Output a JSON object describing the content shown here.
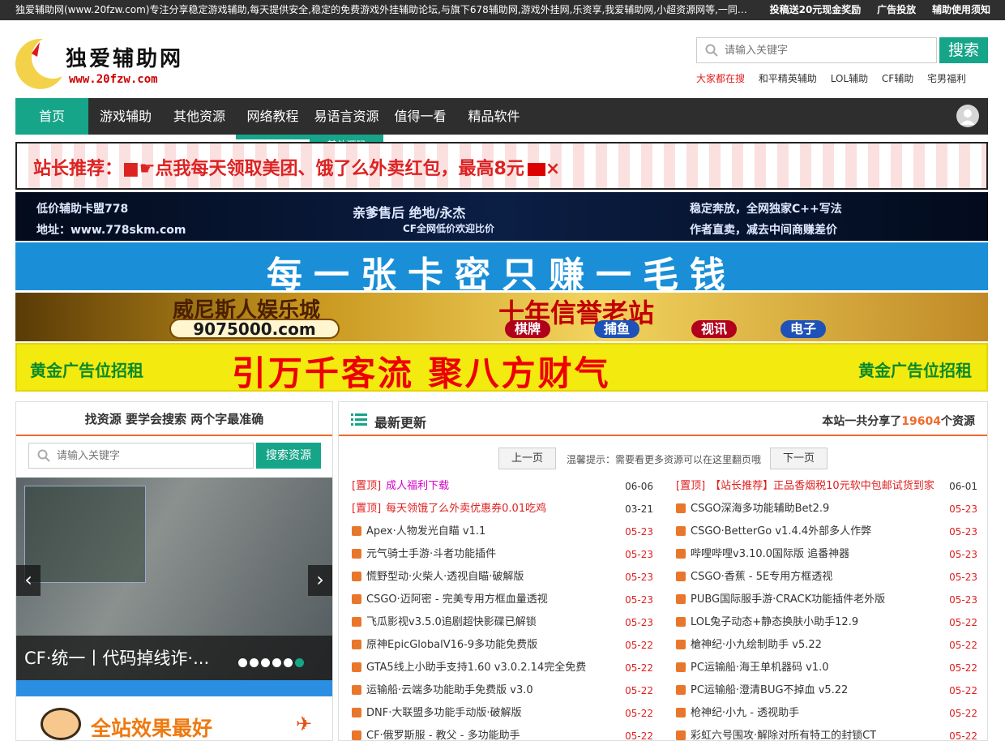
{
  "topbar": {
    "description": "独爱辅助网(www.20fzw.com)专注分享稳定游戏辅助,每天提供安全,稳定的免费游戏外挂辅助论坛,与旗下678辅助网,游戏外挂网,乐资享,我爱辅助网,小超资源网等,一同打造...",
    "links": [
      "投稿送20元现金奖励",
      "广告投放",
      "辅助使用须知"
    ]
  },
  "logo": {
    "name": "独爱辅助网",
    "url": "www.20fzw.com"
  },
  "search": {
    "placeholder": "请输入关键字",
    "button": "搜索"
  },
  "hot": {
    "label": "大家都在搜",
    "items": [
      "和平精英辅助",
      "LOL辅助",
      "CF辅助",
      "宅男福利"
    ]
  },
  "nav": {
    "items": [
      "首页",
      "游戏辅助",
      "其他资源",
      "网络教程",
      "易语言资源",
      "值得一看",
      "精品软件"
    ],
    "dropdown_item": "其他源码"
  },
  "banners": {
    "b1": "站长推荐：■☛点我每天领取美团、饿了么外卖红包，最高8元",
    "b1_close": "×",
    "b2_a": "低价辅助卡盟778",
    "b2_b": "地址：www.778skm.com",
    "b2_c": "亲爹售后  绝地/永杰",
    "b2_d": "CF全网低价欢迎比价",
    "b2_e": "稳定奔放，全网独家C++写法",
    "b2_f": "作者直卖，减去中间商赚差价",
    "b3": "每一张卡密只赚一毛钱",
    "b4_a": "威尼斯人娱乐城",
    "b4_b": "十年信誉老站",
    "b4_c": "9075000.com",
    "b4_tags": [
      "棋牌",
      "捕鱼",
      "视讯",
      "电子"
    ],
    "b5_left": "黄金广告位招租",
    "b5_mid": "引万千客流  聚八方财气",
    "b5_right": "黄金广告位招租"
  },
  "sidebar": {
    "title": "找资源 要学会搜索 两个字最准确",
    "placeholder": "请输入关键字",
    "button": "搜索资源",
    "slider_caption": "CF·统一丨代码掉线诈·...",
    "prev": "‹",
    "next": "›",
    "ad_text": "全站效果最好"
  },
  "main": {
    "title": "最新更新",
    "stat_prefix": "本站一共分享了",
    "stat_num": "19604",
    "stat_suffix": "个资源",
    "prev": "上一页",
    "next": "下一页",
    "tip": "温馨提示：需要看更多资源可以在这里翻页哦",
    "top_label": "[置顶]",
    "left": [
      {
        "title": "成人福利下载",
        "date": "06-06"
      },
      {
        "title": "每天领饿了么外卖优惠券0.01吃鸡",
        "date": "03-21"
      },
      {
        "title": "Apex·人物发光自瞄 v1.1",
        "date": "05-23"
      },
      {
        "title": "元气骑士手游·斗者功能插件",
        "date": "05-23"
      },
      {
        "title": "慌野型动·火柴人·透视自瞄·破解版",
        "date": "05-23"
      },
      {
        "title": "CSGO·迈阿密 - 完美专用方框血量透视",
        "date": "05-23"
      },
      {
        "title": "飞瓜影视v3.5.0追剧超快影碟已解锁",
        "date": "05-23"
      },
      {
        "title": "原神EpicGlobalV16-9多功能免费版",
        "date": "05-22"
      },
      {
        "title": "GTA5线上小助手支持1.60 v3.0.2.14完全免费",
        "date": "05-22"
      },
      {
        "title": "运输船·云端多功能助手免费版 v3.0",
        "date": "05-22"
      },
      {
        "title": "DNF·大联盟多功能手动版·破解版",
        "date": "05-22"
      },
      {
        "title": "CF·俄罗斯服 - 教父 - 多功能助手",
        "date": "05-22"
      }
    ],
    "right": [
      {
        "title": "【站长推荐】正品香烟税10元软中包邮试货到家",
        "date": "06-01"
      },
      {
        "title": "CSGO深海多功能辅助Bet2.9",
        "date": "05-23"
      },
      {
        "title": "CSGO·BetterGo v1.4.4外部多人作弊",
        "date": "05-23"
      },
      {
        "title": "哔哩哔哩v3.10.0国际版 追番神器",
        "date": "05-23"
      },
      {
        "title": "CSGO·香蕉 - 5E专用方框透视",
        "date": "05-23"
      },
      {
        "title": "PUBG国际服手游·CRACK功能插件老外版",
        "date": "05-23"
      },
      {
        "title": "LOL兔子动态+静态换肤小助手12.9",
        "date": "05-22"
      },
      {
        "title": "槍神纪·小九绘制助手 v5.22",
        "date": "05-22"
      },
      {
        "title": "PC运输船·海王单机器码 v1.0",
        "date": "05-22"
      },
      {
        "title": "PC运输船·澄清BUG不掉血 v5.22",
        "date": "05-22"
      },
      {
        "title": "枪神纪·小九 - 透视助手",
        "date": "05-22"
      },
      {
        "title": "彩虹六号围攻·解除对所有特工的封锁CT",
        "date": "05-22"
      }
    ]
  },
  "colors": {
    "accent": "#16a589",
    "orange": "#f06a2a",
    "red": "#e02020",
    "nav": "#2e2e2e"
  }
}
